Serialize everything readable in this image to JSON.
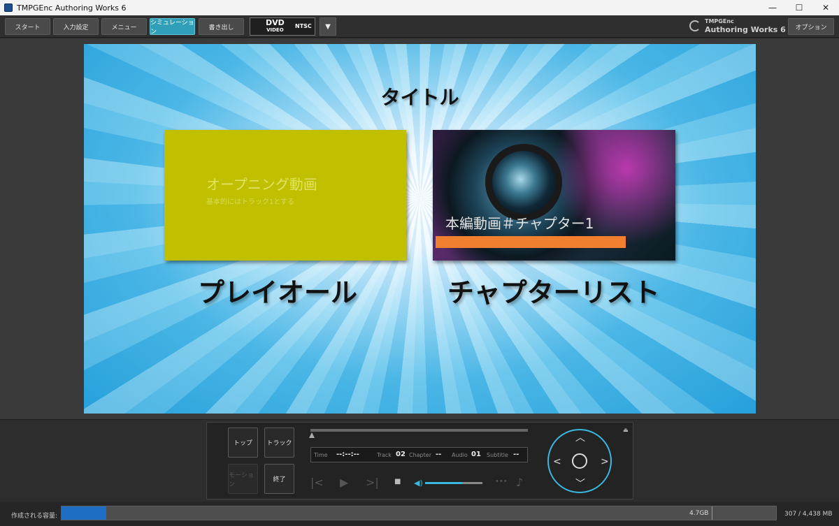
{
  "window": {
    "title": "TMPGEnc Authoring Works 6",
    "minimize_icon": "—",
    "maximize_icon": "☐",
    "close_icon": "✕"
  },
  "toolbar": {
    "tabs": [
      {
        "label": "スタート",
        "active": false
      },
      {
        "label": "入力設定",
        "active": false
      },
      {
        "label": "メニュー",
        "active": false
      },
      {
        "label": "シミュレーション",
        "active": true
      },
      {
        "label": "書き出し",
        "active": false
      }
    ],
    "format": {
      "logo": "DVD",
      "logo_sub": "VIDEO",
      "standard": "NTSC"
    },
    "dropdown_icon": "▼",
    "brand_line1": "TMPGEnc",
    "brand_line2": "Authoring Works 6",
    "options_label": "オプション",
    "accent_color": "#2fa0b8"
  },
  "preview": {
    "menu_title": "タイトル",
    "items": [
      {
        "thumbnail_title": "オープニング動画",
        "thumbnail_subtitle": "基本的にはトラック1とする",
        "label": "プレイオール"
      },
      {
        "thumbnail_title": "本編動画＃チャプター1",
        "label": "チャプターリスト"
      }
    ]
  },
  "controls": {
    "top_button": "トップ",
    "track_button": "トラック",
    "mode_button": "モーション",
    "end_button": "終了",
    "info": {
      "time_label": "Time",
      "time_value": "--:--:--",
      "track_label": "Track",
      "track_value": "02",
      "chapter_label": "Chapter",
      "chapter_value": "--",
      "audio_label": "Audio",
      "audio_value": "01",
      "subtitle_label": "Subtitle",
      "subtitle_value": "--"
    },
    "eject_icon": "⏏",
    "volume_level": 0.65,
    "dpad_accent": "#3bb8e0"
  },
  "status": {
    "capacity_label": "作成される容量:",
    "capacity_max_label": "4.7GB",
    "capacity_value": "307 / 4,438 MB",
    "used_mb": 307,
    "total_mb": 4438,
    "bar_color": "#1e6fc4"
  }
}
